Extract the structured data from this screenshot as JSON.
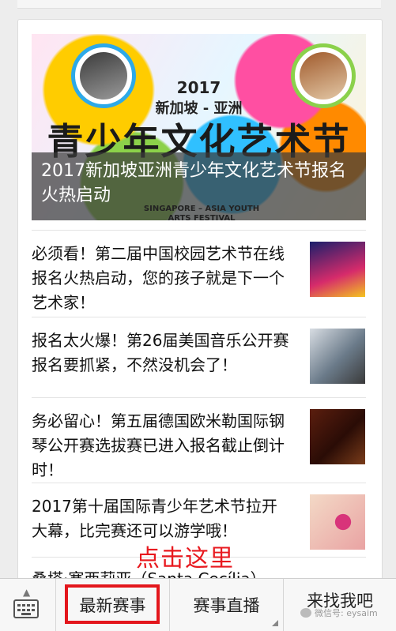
{
  "hero": {
    "year": "2017",
    "location": "新加坡 - 亚洲",
    "big_title": "青少年文化艺术节",
    "english_name": "SINGAPORE – ASIA YOUTH ARTS FESTIVAL",
    "caption": "2017新加坡亚洲青少年文化艺术节报名火热启动"
  },
  "articles": [
    {
      "title": "必须看！第二届中国校园艺术节在线报名火热启动，您的孩子就是下一个艺术家！",
      "thumb": "campus-festival-poster"
    },
    {
      "title": "报名太火爆！第26届美国音乐公开赛报名要抓紧，不然没机会了！",
      "thumb": "violinist-photo"
    },
    {
      "title": "务必留心！第五届德国欧米勒国际钢琴公开赛选拔赛已进入报名截止倒计时！",
      "thumb": "piano-keys-photo"
    },
    {
      "title": "2017第十届国际青少年艺术节拉开大幕，比完赛还可以游学哦！",
      "thumb": "music-note-art"
    },
    {
      "title": "桑塔·塞西莉亚（Santa Cecília）"
    }
  ],
  "annotation": {
    "click_here": "点击这里",
    "color": "#e8191f"
  },
  "bottom_menu": {
    "keyboard_icon": "keyboard-icon",
    "items": [
      "最新赛事",
      "赛事直播",
      "来找我吧"
    ]
  },
  "watermark": "微信号: eysaim"
}
